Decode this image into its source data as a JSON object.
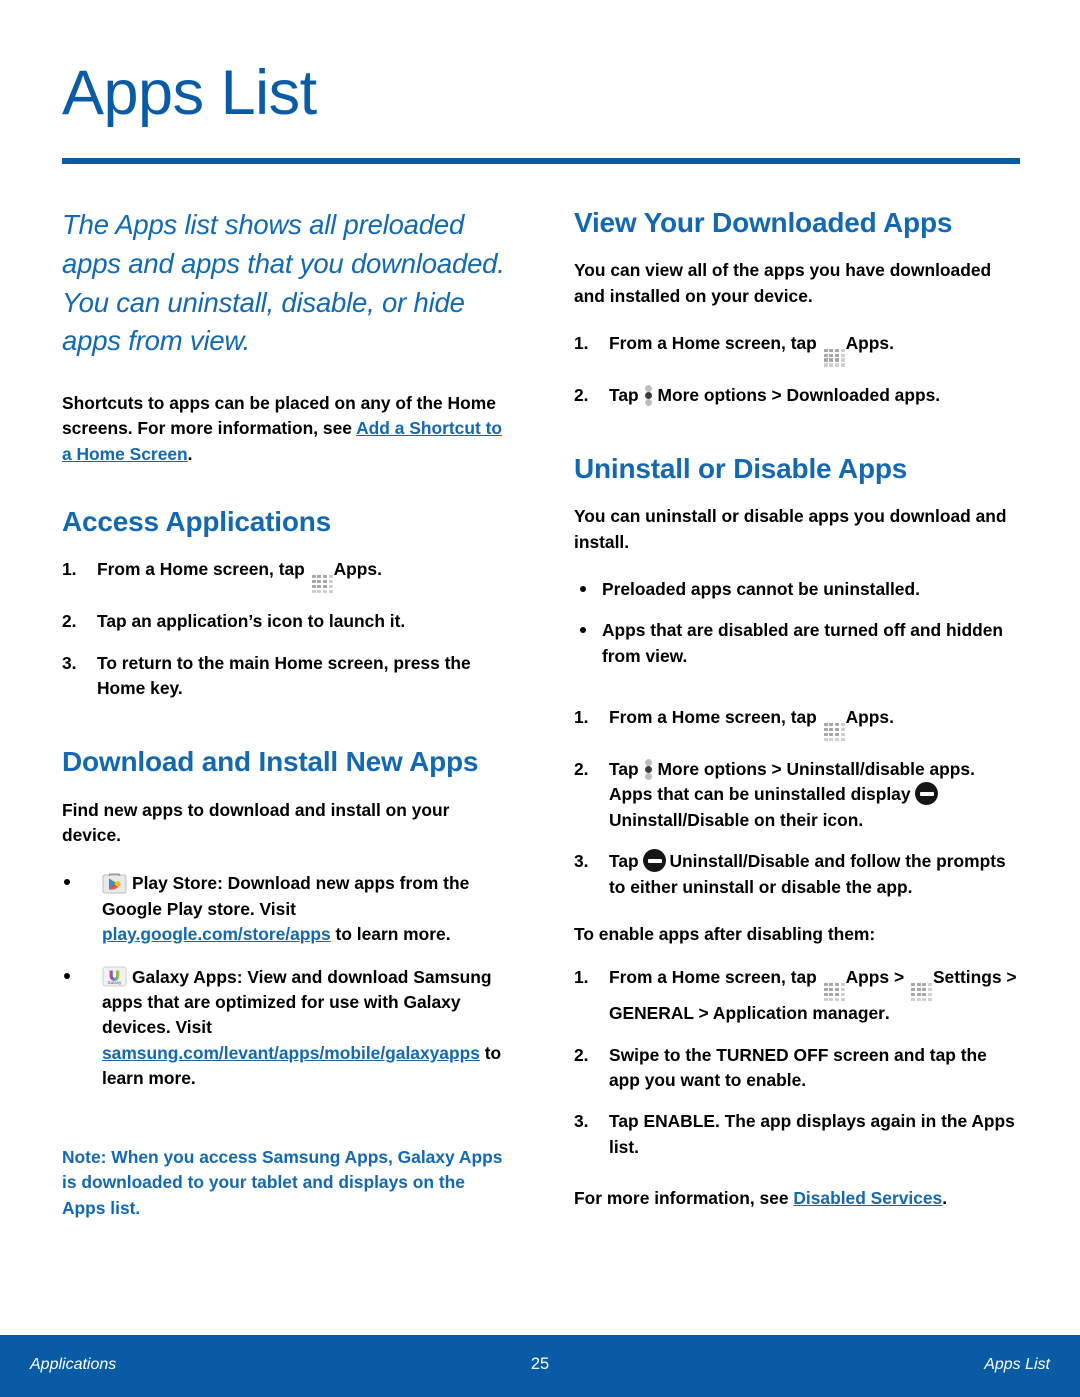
{
  "page": {
    "title": "Apps List",
    "accent_color": "#0a5ba6",
    "heading_color": "#1368b2"
  },
  "left_column": {
    "lead": "The Apps list shows all preloaded apps and apps that you downloaded. You can uninstall, disable, or hide apps from view.",
    "intro_paragraph_part1": "Shortcuts to apps can be placed on any of the Home screens. For more information, see ",
    "intro_link": "Add a Shortcut to a Home Screen",
    "intro_paragraph_end": ".",
    "access": {
      "heading": "Access Applications",
      "steps": [
        {
          "num": "1.",
          "pre": "From a Home screen, tap ",
          "icon": "apps-grid-icon",
          "bold": "Apps",
          "post": "."
        },
        {
          "num": "2.",
          "pre": "Tap an application’s icon to launch it.",
          "icon": "",
          "bold": "",
          "post": ""
        },
        {
          "num": "3.",
          "pre": "To return to the main Home screen, press the ",
          "icon": "",
          "bold": "Home",
          "post": " key."
        }
      ]
    },
    "download": {
      "heading": "Download and Install New Apps",
      "intro": "Find new apps to download and install on your device.",
      "bullets": [
        {
          "icon": "play-store-icon",
          "bold": "Play Store",
          "pre": ": Download new apps from the Google Play store. Visit ",
          "link": "play.google.com/store/apps",
          "post": " to learn more."
        },
        {
          "icon": "galaxy-apps-icon",
          "bold": "Galaxy Apps",
          "pre": ": View and download Samsung apps that are optimized for use with Galaxy devices. Visit ",
          "link": "samsung.com/levant/apps/mobile/galaxyapps",
          "post": " to learn more."
        }
      ],
      "note_label": "Note",
      "note_text": ": When you access Samsung Apps, Galaxy Apps is downloaded to your tablet and displays on the Apps list."
    }
  },
  "right_column": {
    "view_downloaded": {
      "heading": "View Your Downloaded Apps",
      "intro": "You can view all of the apps you have downloaded and installed on your device.",
      "steps": [
        {
          "num": "1.",
          "pre": "From a Home screen, tap ",
          "icon": "apps-grid-icon",
          "bold": "Apps",
          "post": "."
        },
        {
          "num": "2.",
          "pre": "Tap ",
          "icon": "more-options-icon",
          "bold": "More options > Downloaded apps",
          "post": "."
        }
      ]
    },
    "uninstall": {
      "heading": "Uninstall or Disable Apps",
      "intro": "You can uninstall or disable apps you download and install.",
      "bullets": [
        "Preloaded apps cannot be uninstalled.",
        "Apps that are disabled are turned off and hidden from view."
      ],
      "step1": {
        "num": "1.",
        "pre": "From a Home screen, tap ",
        "bold": "Apps",
        "post": "."
      },
      "step2": {
        "num": "2.",
        "pre": "Tap ",
        "bold1": "More options > Uninstall/disable apps",
        "mid": ". Apps that can be uninstalled display ",
        "bold2": "Uninstall/Disable",
        "post": " on their icon."
      },
      "step3": {
        "num": "3.",
        "pre": "Tap ",
        "bold": "Uninstall/Disable",
        "post": " and follow the prompts to either uninstall or disable the app."
      },
      "enable_intro": "To enable apps after disabling them:",
      "enable_steps": [
        {
          "num": "1.",
          "pre": "From a Home screen, tap ",
          "bold1": "Apps",
          "sep": " > ",
          "bold2": "Settings > GENERAL > Application manager",
          "post": "."
        },
        {
          "num": "2.",
          "pre": "Swipe to the TURNED OFF screen and tap the app you want to enable.",
          "bold1": "",
          "sep": "",
          "bold2": "",
          "post": ""
        },
        {
          "num": "3.",
          "pre": "Tap ",
          "bold1": "ENABLE",
          "sep": "",
          "bold2": "",
          "post": ". The app displays again in the Apps list."
        }
      ],
      "more_info_pre": "For more information, see ",
      "more_info_link": "Disabled Services",
      "more_info_post": "."
    }
  },
  "footer": {
    "left": "Applications",
    "page_number": "25",
    "right": "Apps List"
  }
}
